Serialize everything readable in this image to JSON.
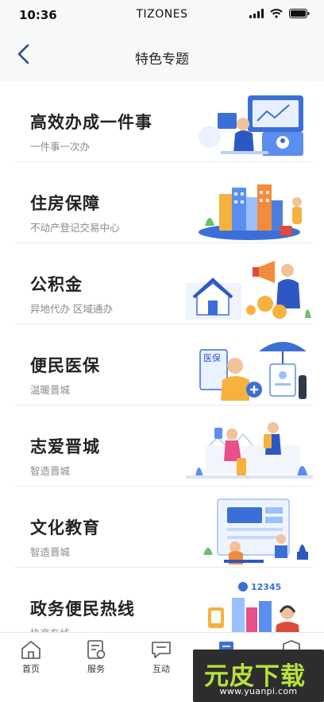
{
  "status_bar": {
    "time": "10:36",
    "carrier": "TIZONES"
  },
  "header": {
    "title": "特色专题",
    "back_icon": "chevron-left-icon"
  },
  "topics": [
    {
      "title": "高效办成一件事",
      "subtitle": "一件事一次办"
    },
    {
      "title": "住房保障",
      "subtitle": "不动产登记交易中心"
    },
    {
      "title": "公积金",
      "subtitle": "异地代办 区域通办"
    },
    {
      "title": "便民医保",
      "subtitle": "温暖晋城",
      "illustration_text": "医保"
    },
    {
      "title": "志爱晋城",
      "subtitle": "智造晋城"
    },
    {
      "title": "文化教育",
      "subtitle": "智造晋城"
    },
    {
      "title": "政务便民热线",
      "subtitle": "协商在线",
      "illustration_text": "12345"
    }
  ],
  "tab_bar": {
    "items": [
      {
        "label": "首页",
        "icon": "home-icon"
      },
      {
        "label": "服务",
        "icon": "service-doc-icon"
      },
      {
        "label": "互动",
        "icon": "chat-icon"
      },
      {
        "label": "",
        "icon": "book-icon"
      },
      {
        "label": "",
        "icon": "shield-icon"
      }
    ]
  },
  "watermark": {
    "logo_text": "元皮下载",
    "url": "www.yuanpi.com",
    "logo_color": "#b8e23b"
  },
  "colors": {
    "accent_blue": "#3b6fd8",
    "back_arrow": "#2a4a8a",
    "subtitle_gray": "#8a8a8a"
  }
}
